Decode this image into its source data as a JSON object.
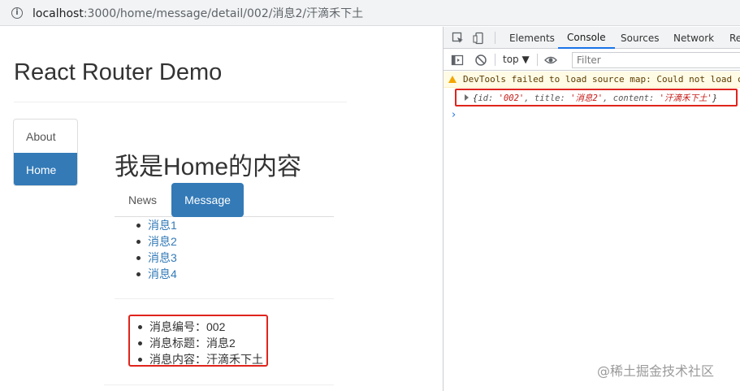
{
  "browser": {
    "url_host": "localhost",
    "url_path": ":3000/home/message/detail/002/消息2/汗滴禾下土"
  },
  "page": {
    "app_title": "React Router Demo",
    "nav": [
      {
        "label": "About",
        "active": false
      },
      {
        "label": "Home",
        "active": true
      }
    ],
    "home_title": "我是Home的内容",
    "tabs": [
      {
        "label": "News",
        "active": false
      },
      {
        "label": "Message",
        "active": true
      }
    ],
    "messages": [
      "消息1",
      "消息2",
      "消息3",
      "消息4"
    ],
    "detail": [
      "消息编号：002",
      "消息标题：消息2",
      "消息内容：汗滴禾下土"
    ]
  },
  "devtools": {
    "tabs": [
      "Elements",
      "Console",
      "Sources",
      "Network",
      "Re"
    ],
    "active_tab": "Console",
    "context": "top",
    "filter_placeholder": "Filter",
    "warning": "DevTools failed to load source map: Could not load c",
    "log": {
      "open": "{",
      "id_key": "id: ",
      "id_val": "'002'",
      "title_key": ", title: ",
      "title_val": "'消息2'",
      "content_key": ", content: ",
      "content_val": "'汗滴禾下土'",
      "close": "}"
    },
    "prompt": "›"
  },
  "watermark": "@稀土掘金技术社区",
  "colors": {
    "primary": "#337ab7",
    "highlight": "#e0241c",
    "devtools_accent": "#1a73e8"
  }
}
